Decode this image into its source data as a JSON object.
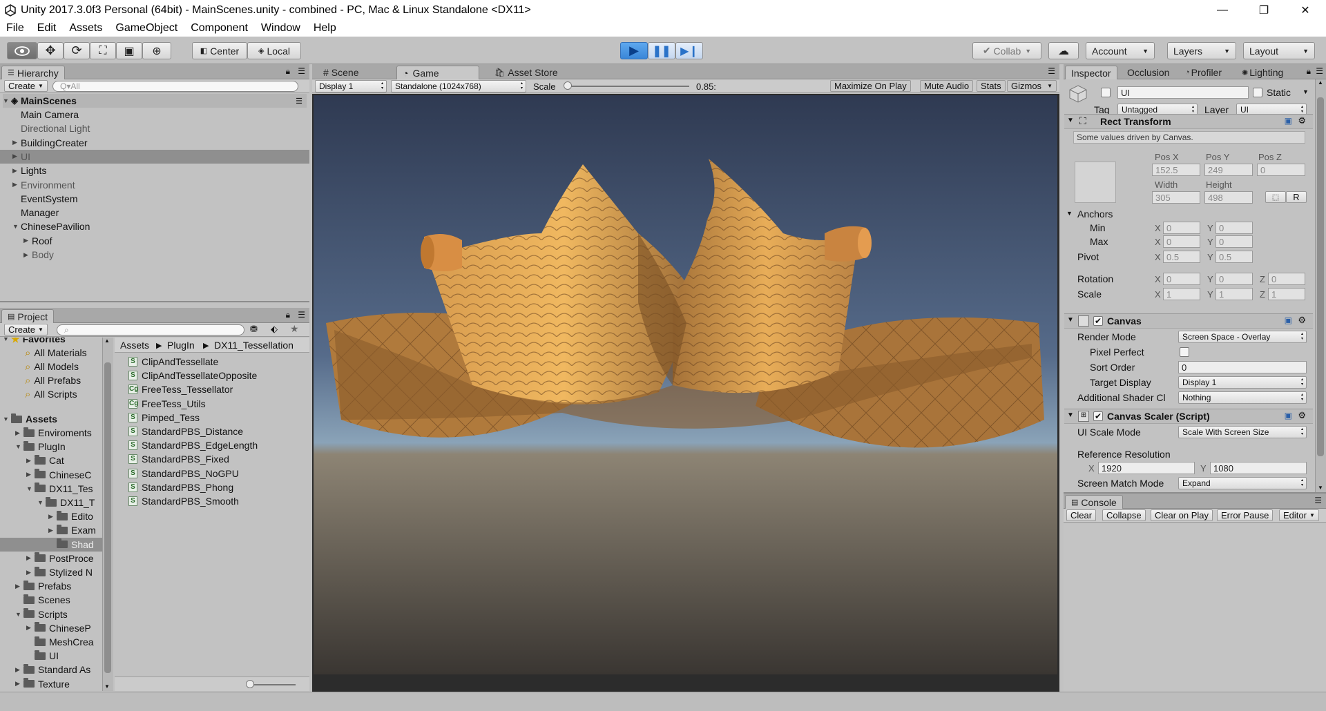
{
  "window": {
    "title": "Unity 2017.3.0f3 Personal (64bit) - MainScenes.unity - combined - PC, Mac & Linux Standalone <DX11>",
    "controls": [
      "—",
      "❐",
      "✕"
    ]
  },
  "menu": [
    "File",
    "Edit",
    "Assets",
    "GameObject",
    "Component",
    "Window",
    "Help"
  ],
  "toolbar": {
    "center_label": "Center",
    "local_label": "Local",
    "collab_label": "Collab",
    "account_label": "Account",
    "layers_label": "Layers",
    "layout_label": "Layout"
  },
  "hierarchy": {
    "tab": "Hierarchy",
    "create": "Create",
    "search_placeholder": "Q▾All",
    "scene": "MainScenes",
    "items": [
      {
        "label": "Main Camera",
        "indent": 1,
        "arrow": "",
        "dim": false
      },
      {
        "label": "Directional Light",
        "indent": 1,
        "arrow": "",
        "dim": true
      },
      {
        "label": "BuildingCreater",
        "indent": 1,
        "arrow": "▶",
        "dim": false
      },
      {
        "label": "UI",
        "indent": 1,
        "arrow": "▶",
        "dim": true,
        "selected": true
      },
      {
        "label": "Lights",
        "indent": 1,
        "arrow": "▶",
        "dim": false
      },
      {
        "label": "Environment",
        "indent": 1,
        "arrow": "▶",
        "dim": true
      },
      {
        "label": "EventSystem",
        "indent": 1,
        "arrow": "",
        "dim": false
      },
      {
        "label": "Manager",
        "indent": 1,
        "arrow": "",
        "dim": false
      },
      {
        "label": "ChinesePavilion",
        "indent": 1,
        "arrow": "▼",
        "dim": false
      },
      {
        "label": "Roof",
        "indent": 2,
        "arrow": "▶",
        "dim": false
      },
      {
        "label": "Body",
        "indent": 2,
        "arrow": "▶",
        "dim": true
      }
    ]
  },
  "project": {
    "tab": "Project",
    "create": "Create",
    "favorites_label": "Favorites",
    "favorites": [
      "All Materials",
      "All Models",
      "All Prefabs",
      "All Scripts"
    ],
    "assets_label": "Assets",
    "folders": [
      {
        "label": "Enviroments",
        "indent": 1,
        "arrow": "▶"
      },
      {
        "label": "PlugIn",
        "indent": 1,
        "arrow": "▼"
      },
      {
        "label": "Cat",
        "indent": 2,
        "arrow": "▶"
      },
      {
        "label": "ChineseC",
        "indent": 2,
        "arrow": "▶"
      },
      {
        "label": "DX11_Tes",
        "indent": 2,
        "arrow": "▼"
      },
      {
        "label": "DX11_T",
        "indent": 3,
        "arrow": "▼"
      },
      {
        "label": "Edito",
        "indent": 4,
        "arrow": "▶"
      },
      {
        "label": "Exam",
        "indent": 4,
        "arrow": "▶"
      },
      {
        "label": "Shad",
        "indent": 4,
        "arrow": "",
        "selected": true
      },
      {
        "label": "PostProce",
        "indent": 2,
        "arrow": "▶"
      },
      {
        "label": "Stylized N",
        "indent": 2,
        "arrow": "▶"
      },
      {
        "label": "Prefabs",
        "indent": 1,
        "arrow": "▶"
      },
      {
        "label": "Scenes",
        "indent": 1,
        "arrow": ""
      },
      {
        "label": "Scripts",
        "indent": 1,
        "arrow": "▼"
      },
      {
        "label": "ChineseP",
        "indent": 2,
        "arrow": "▶"
      },
      {
        "label": "MeshCrea",
        "indent": 2,
        "arrow": ""
      },
      {
        "label": "UI",
        "indent": 2,
        "arrow": ""
      },
      {
        "label": "Standard As",
        "indent": 1,
        "arrow": "▶"
      },
      {
        "label": "Texture",
        "indent": 1,
        "arrow": "▶"
      }
    ],
    "breadcrumb": [
      "Assets",
      "PlugIn",
      "DX11_Tessellation"
    ],
    "files": [
      {
        "label": "ClipAndTessellate",
        "icon": "S"
      },
      {
        "label": "ClipAndTessellateOpposite",
        "icon": "S"
      },
      {
        "label": "FreeTess_Tessellator",
        "icon": "Cg"
      },
      {
        "label": "FreeTess_Utils",
        "icon": "Cg"
      },
      {
        "label": "Pimped_Tess",
        "icon": "S"
      },
      {
        "label": "StandardPBS_Distance",
        "icon": "S"
      },
      {
        "label": "StandardPBS_EdgeLength",
        "icon": "S"
      },
      {
        "label": "StandardPBS_Fixed",
        "icon": "S"
      },
      {
        "label": "StandardPBS_NoGPU",
        "icon": "S"
      },
      {
        "label": "StandardPBS_Phong",
        "icon": "S"
      },
      {
        "label": "StandardPBS_Smooth",
        "icon": "S"
      }
    ]
  },
  "center": {
    "tabs": [
      "Scene",
      "Game",
      "Asset Store"
    ],
    "display": "Display 1",
    "resolution": "Standalone (1024x768)",
    "scale_label": "Scale",
    "scale_value": "0.85:",
    "scale_fraction": 0.02,
    "toggles": [
      "Maximize On Play",
      "Mute Audio",
      "Stats",
      "Gizmos"
    ]
  },
  "inspector": {
    "tabs": [
      "Inspector",
      "Occlusion",
      "Profiler",
      "Lighting"
    ],
    "object_name": "UI",
    "static_label": "Static",
    "tag_label": "Tag",
    "tag_value": "Untagged",
    "layer_label": "Layer",
    "layer_value": "UI",
    "rect": {
      "title": "Rect Transform",
      "note": "Some values driven by Canvas.",
      "posx_label": "Pos X",
      "posy_label": "Pos Y",
      "posz_label": "Pos Z",
      "posx": "152.5",
      "posy": "249",
      "posz": "0",
      "width_label": "Width",
      "height_label": "Height",
      "width": "305",
      "height": "498",
      "r_label": "R",
      "anchors_label": "Anchors",
      "min_label": "Min",
      "max_label": "Max",
      "min_x": "0",
      "min_y": "0",
      "max_x": "0",
      "max_y": "0",
      "pivot_label": "Pivot",
      "pivot_x": "0.5",
      "pivot_y": "0.5",
      "rotation_label": "Rotation",
      "rot_x": "0",
      "rot_y": "0",
      "rot_z": "0",
      "scale_label": "Scale",
      "scale_x": "1",
      "scale_y": "1",
      "scale_z": "1",
      "x": "X",
      "y": "Y",
      "z": "Z"
    },
    "canvas": {
      "title": "Canvas",
      "render_mode_label": "Render Mode",
      "render_mode": "Screen Space - Overlay",
      "pixel_perfect_label": "Pixel Perfect",
      "sort_order_label": "Sort Order",
      "sort_order": "0",
      "target_display_label": "Target Display",
      "target_display": "Display 1",
      "shader_label": "Additional Shader Cl",
      "shader": "Nothing"
    },
    "scaler": {
      "title": "Canvas Scaler (Script)",
      "ui_scale_label": "UI Scale Mode",
      "ui_scale": "Scale With Screen Size",
      "ref_label": "Reference Resolution",
      "ref_x": "1920",
      "ref_y": "1080",
      "match_label": "Screen Match Mode",
      "match": "Expand"
    }
  },
  "console": {
    "tab": "Console",
    "buttons": [
      "Clear",
      "Collapse",
      "Clear on Play",
      "Error Pause",
      "Editor"
    ]
  },
  "colors": {
    "accent": "#3a86d8",
    "panel": "#c2c2c2",
    "selection": "#8f8f8f"
  }
}
